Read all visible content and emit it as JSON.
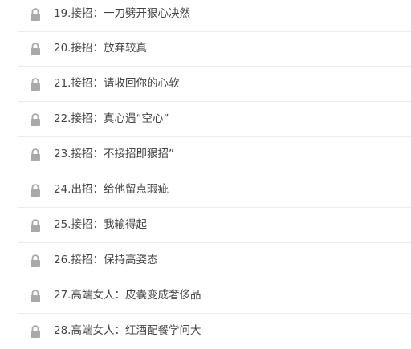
{
  "lessons": [
    {
      "title": "19.接招：一刀劈开狠心决然",
      "locked": true
    },
    {
      "title": "20.接招：放弃较真",
      "locked": true
    },
    {
      "title": "21.接招：请收回你的心软",
      "locked": true
    },
    {
      "title": "22.接招：真心遇“空心”",
      "locked": true
    },
    {
      "title": "23.接招：不接招即狠招”",
      "locked": true
    },
    {
      "title": "24.出招：给他留点瑕疵",
      "locked": true
    },
    {
      "title": "25.接招：我输得起",
      "locked": true
    },
    {
      "title": "26.接招：保持高姿态",
      "locked": true
    },
    {
      "title": "27.高端女人：皮囊变成奢侈品",
      "locked": true
    },
    {
      "title": "28.高端女人：红酒配餐学问大",
      "locked": true
    }
  ],
  "icon": "lock-icon",
  "colors": {
    "icon": "#a9a9a9",
    "text": "#444444",
    "divider": "#ececec"
  }
}
